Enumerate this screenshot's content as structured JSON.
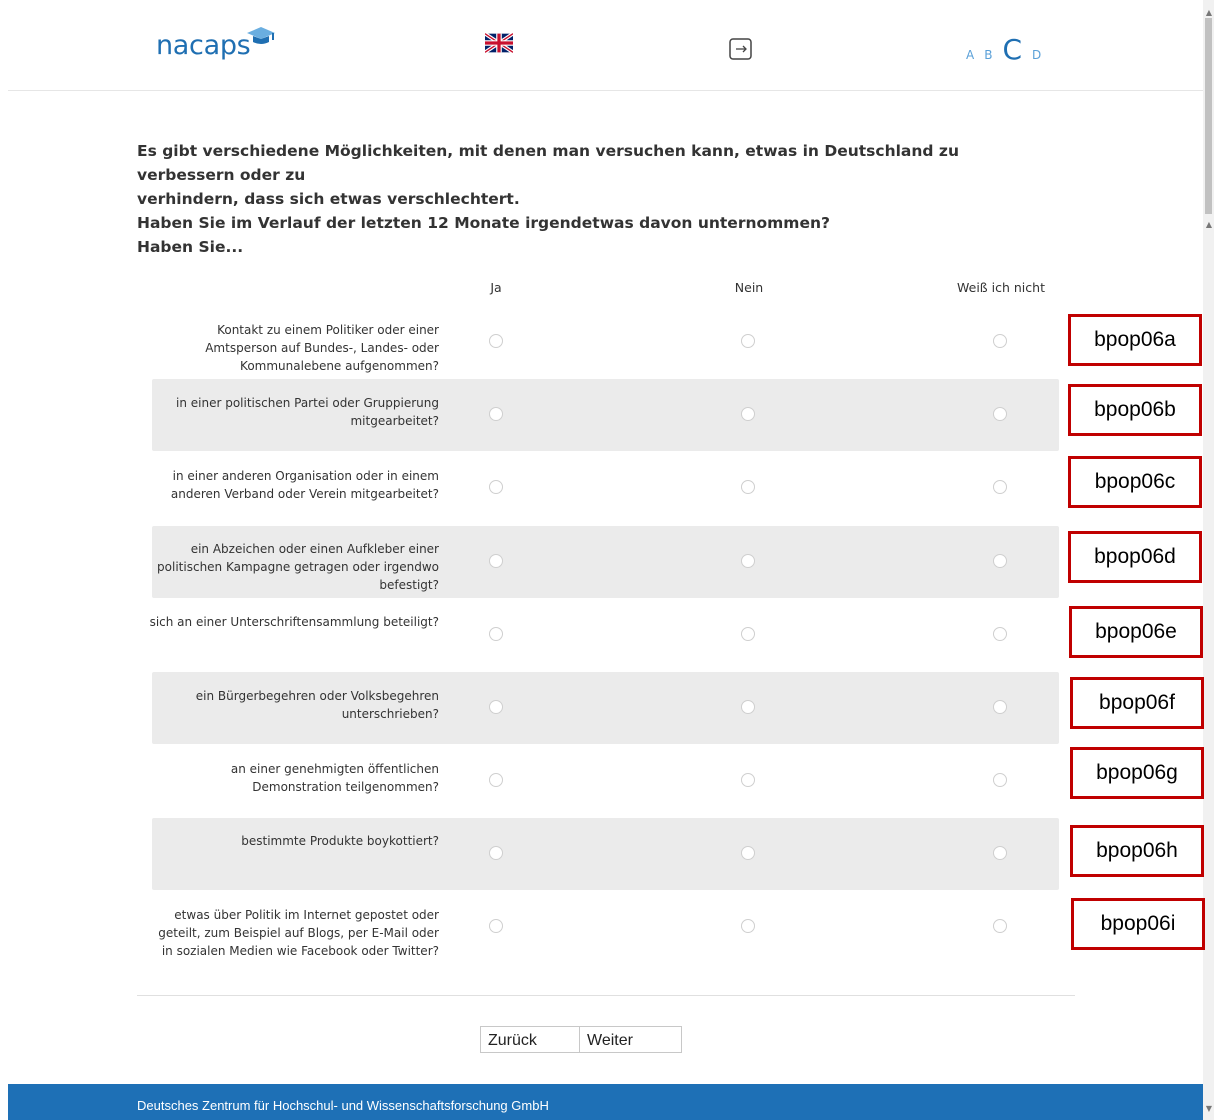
{
  "header": {
    "logo_text": "nacaps",
    "font_size_options": [
      "A",
      "B",
      "C",
      "D"
    ],
    "selected_font_size": "C"
  },
  "question": {
    "text_line1": "Es gibt verschiedene Möglichkeiten, mit denen man versuchen kann, etwas in Deutschland zu verbessern oder zu",
    "text_line2": "verhindern, dass sich etwas verschlechtert.",
    "text_line3": "Haben Sie im Verlauf der letzten 12 Monate irgendetwas davon unternommen?",
    "sub_heading": "Haben Sie..."
  },
  "columns": [
    "Ja",
    "Nein",
    "Weiß ich nicht"
  ],
  "items": [
    {
      "label": "Kontakt zu einem Politiker oder einer Amtsperson auf Bundes-, Landes- oder Kommunalebene aufgenommen?",
      "tag": "bpop06a"
    },
    {
      "label": "in einer politischen Partei oder Gruppierung mitgearbeitet?",
      "tag": "bpop06b"
    },
    {
      "label": "in einer anderen Organisation oder in einem anderen Verband oder Verein mitgearbeitet?",
      "tag": "bpop06c"
    },
    {
      "label": "ein Abzeichen oder einen Aufkleber einer politischen Kampagne getragen oder irgendwo befestigt?",
      "tag": "bpop06d"
    },
    {
      "label": "sich an einer Unterschriftensammlung beteiligt?",
      "tag": "bpop06e"
    },
    {
      "label": "ein Bürgerbegehren oder Volksbegehren unterschrieben?",
      "tag": "bpop06f"
    },
    {
      "label": "an einer genehmigten öffentlichen Demonstration teilgenommen?",
      "tag": "bpop06g"
    },
    {
      "label": "bestimmte Produkte boykottiert?",
      "tag": "bpop06h"
    },
    {
      "label": "etwas über Politik im Internet gepostet oder geteilt, zum Beispiel auf Blogs, per E-Mail oder in sozialen Medien wie Facebook oder Twitter?",
      "tag": "bpop06i"
    }
  ],
  "nav": {
    "back_label": "Zurück",
    "next_label": "Weiter"
  },
  "footer": {
    "text": "Deutsches Zentrum für Hochschul- und Wissenschaftsforschung GmbH"
  },
  "colors": {
    "brand_blue": "#1e70b6",
    "tag_border": "#c00000",
    "row_alt": "#ebebeb"
  }
}
